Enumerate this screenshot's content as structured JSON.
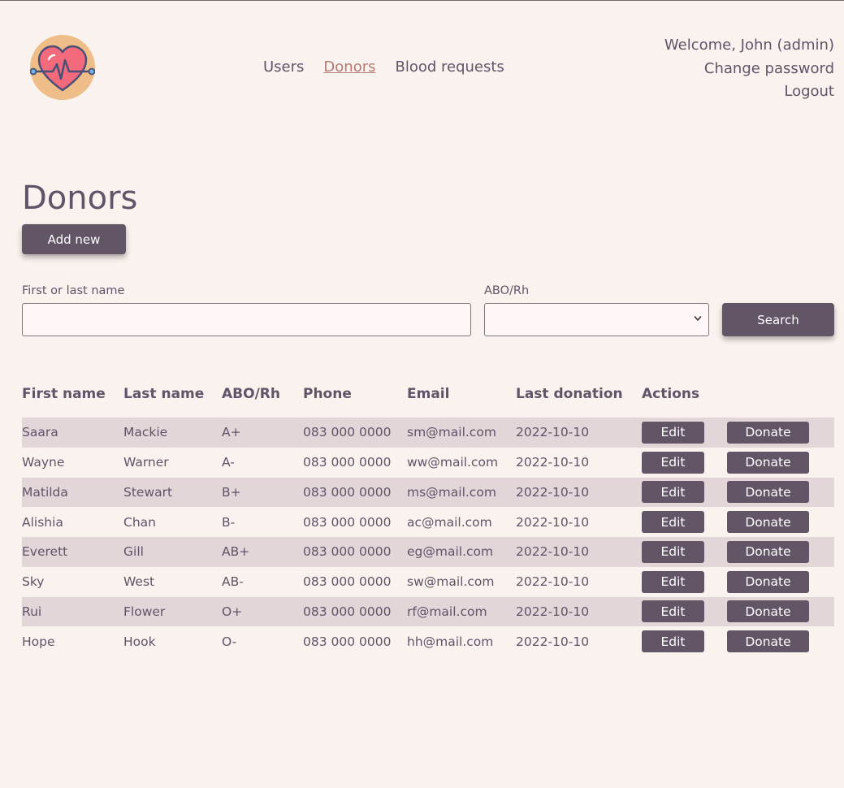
{
  "nav": {
    "items": [
      {
        "label": "Users"
      },
      {
        "label": "Donors"
      },
      {
        "label": "Blood requests"
      }
    ]
  },
  "user": {
    "welcome": "Welcome, John (admin)",
    "change_password": "Change password",
    "logout": "Logout"
  },
  "page": {
    "title": "Donors",
    "add_label": "Add new"
  },
  "search": {
    "name_label": "First or last name",
    "name_value": "",
    "abo_label": "ABO/Rh",
    "abo_value": "",
    "button_label": "Search"
  },
  "table": {
    "columns": [
      "First name",
      "Last name",
      "ABO/Rh",
      "Phone",
      "Email",
      "Last donation",
      "Actions"
    ],
    "edit_label": "Edit",
    "donate_label": "Donate",
    "rows": [
      {
        "first": "Saara",
        "last": "Mackie",
        "abo": "A+",
        "phone": "083 000 0000",
        "email": "sm@mail.com",
        "last_donation": "2022-10-10"
      },
      {
        "first": "Wayne",
        "last": "Warner",
        "abo": "A-",
        "phone": "083 000 0000",
        "email": "ww@mail.com",
        "last_donation": "2022-10-10"
      },
      {
        "first": "Matilda",
        "last": "Stewart",
        "abo": "B+",
        "phone": "083 000 0000",
        "email": "ms@mail.com",
        "last_donation": "2022-10-10"
      },
      {
        "first": "Alishia",
        "last": "Chan",
        "abo": "B-",
        "phone": "083 000 0000",
        "email": "ac@mail.com",
        "last_donation": "2022-10-10"
      },
      {
        "first": "Everett",
        "last": "Gill",
        "abo": "AB+",
        "phone": "083 000 0000",
        "email": "eg@mail.com",
        "last_donation": "2022-10-10"
      },
      {
        "first": "Sky",
        "last": "West",
        "abo": "AB-",
        "phone": "083 000 0000",
        "email": "sw@mail.com",
        "last_donation": "2022-10-10"
      },
      {
        "first": "Rui",
        "last": "Flower",
        "abo": "O+",
        "phone": "083 000 0000",
        "email": "rf@mail.com",
        "last_donation": "2022-10-10"
      },
      {
        "first": "Hope",
        "last": "Hook",
        "abo": "O-",
        "phone": "083 000 0000",
        "email": "hh@mail.com",
        "last_donation": "2022-10-10"
      }
    ]
  },
  "icons": {
    "logo": "heart-pulse-icon",
    "select_arrow": "chevron-down-icon"
  },
  "colors": {
    "background": "#faf2ee",
    "text": "#5f5468",
    "accent": "#b47a73",
    "button": "#615566",
    "row_stripe": "#e2d6d9",
    "logo_circle": "#efbd87",
    "logo_heart": "#f36a7c"
  }
}
